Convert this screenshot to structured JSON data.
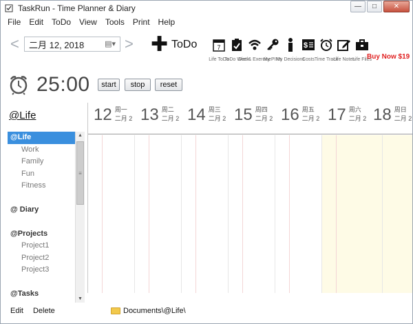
{
  "window": {
    "title": "TaskRun - Time Planner & Diary",
    "min": "—",
    "max": "□",
    "close": "✕"
  },
  "menu": [
    "File",
    "Edit",
    "ToDo",
    "View",
    "Tools",
    "Print",
    "Help"
  ],
  "toolbar": {
    "prev": "<",
    "next": ">",
    "date": "二月   12, 2018",
    "todo_label": "ToDo",
    "tools": [
      {
        "icon": "calendar-7-icon",
        "label": "Life ToDo"
      },
      {
        "icon": "clipboard-check-icon",
        "label": "ToDo Week"
      },
      {
        "icon": "wifi-icon",
        "label": "Diet & Exercise"
      },
      {
        "icon": "key-icon",
        "label": "My PINs"
      },
      {
        "icon": "person-icon",
        "label": "My Decisions"
      },
      {
        "icon": "cost-icon",
        "label": "Costs"
      },
      {
        "icon": "alarm-clock-icon",
        "label": "Time Track"
      },
      {
        "icon": "edit-icon",
        "label": "Life Notes"
      },
      {
        "icon": "briefcase-icon",
        "label": "Life Files"
      }
    ],
    "buy_now": "Buy Now $19"
  },
  "timer": {
    "value": "25:00",
    "start": "start",
    "stop": "stop",
    "reset": "reset"
  },
  "left": {
    "heading": "@Life",
    "tree": [
      {
        "label": "@Life",
        "type": "group",
        "selected": true
      },
      {
        "label": "Work",
        "type": "child"
      },
      {
        "label": "Family",
        "type": "child"
      },
      {
        "label": "Fun",
        "type": "child"
      },
      {
        "label": "Fitness",
        "type": "child"
      },
      {
        "label": "",
        "type": "gap"
      },
      {
        "label": "@ Diary",
        "type": "group"
      },
      {
        "label": "",
        "type": "gap"
      },
      {
        "label": "@Projects",
        "type": "group"
      },
      {
        "label": "Project1",
        "type": "child"
      },
      {
        "label": "Project2",
        "type": "child"
      },
      {
        "label": "Project3",
        "type": "child"
      },
      {
        "label": "",
        "type": "gap"
      },
      {
        "label": "@Tasks",
        "type": "group"
      }
    ],
    "edit": "Edit",
    "delete": "Delete"
  },
  "calendar": {
    "days": [
      {
        "num": "12",
        "weekday": "",
        "month": ""
      },
      {
        "num": "13",
        "weekday": "周一",
        "month": "二月 2"
      },
      {
        "num": "14",
        "weekday": "周二",
        "month": "二月 2"
      },
      {
        "num": "15",
        "weekday": "周三",
        "month": "二月 2"
      },
      {
        "num": "16",
        "weekday": "周四",
        "month": "二月 2"
      },
      {
        "num": "17",
        "weekday": "周五",
        "month": "二月 2"
      },
      {
        "num": "18",
        "weekday": "周六",
        "month": "二月 2"
      },
      {
        "num": "",
        "weekday": "周日",
        "month": "二月 2"
      }
    ],
    "weekend_bg": "#fefbe6"
  },
  "status": {
    "path": "Documents\\@Life\\"
  }
}
